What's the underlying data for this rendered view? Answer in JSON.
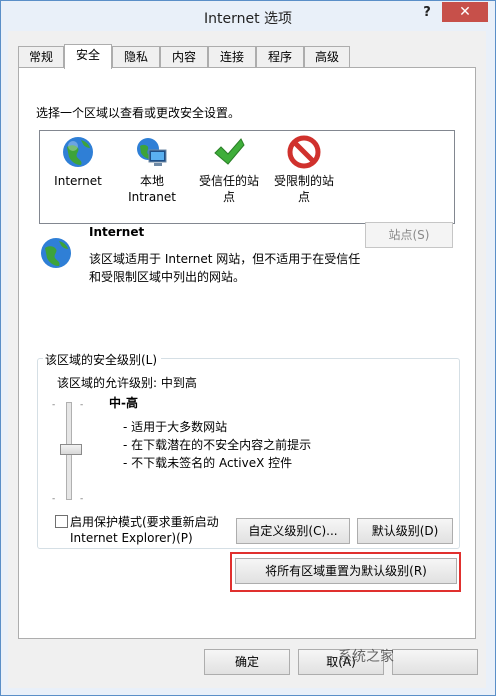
{
  "window": {
    "title": "Internet 选项",
    "help_label": "?",
    "close_label": "✕"
  },
  "tabs": [
    {
      "label": "常规"
    },
    {
      "label": "安全"
    },
    {
      "label": "隐私"
    },
    {
      "label": "内容"
    },
    {
      "label": "连接"
    },
    {
      "label": "程序"
    },
    {
      "label": "高级"
    }
  ],
  "security": {
    "select_zone_text": "选择一个区域以查看或更改安全设置。",
    "zones": [
      {
        "line1": "Internet",
        "line2": "",
        "icon": "globe-icon"
      },
      {
        "line1": "本地",
        "line2": "Intranet",
        "icon": "intranet-icon"
      },
      {
        "line1": "受信任的站",
        "line2": "点",
        "icon": "green-check-icon"
      },
      {
        "line1": "受限制的站",
        "line2": "点",
        "icon": "red-prohibited-icon"
      }
    ],
    "selected_zone": {
      "name": "Internet",
      "desc1": "该区域适用于 Internet 网站，但不适用于在受信任",
      "desc2": "和受限制区域中列出的网站。"
    },
    "sites_button": "站点(S)",
    "level_group": {
      "legend": "该区域的安全级别(L)",
      "allowed": "该区域的允许级别: 中到高",
      "level_name": "中-高",
      "bullets": [
        "- 适用于大多数网站",
        "- 在下载潜在的不安全内容之前提示",
        "- 不下载未签名的 ActiveX 控件"
      ],
      "slider_level": 0.5
    },
    "protected_mode": {
      "line1": "启用保护模式(要求重新启动",
      "line2": "Internet Explorer)(P)",
      "checked": false
    },
    "custom_level_button": "自定义级别(C)...",
    "default_level_button": "默认级别(D)",
    "reset_all_button": "将所有区域重置为默认级别(R)"
  },
  "footer": {
    "ok_label": "确定",
    "cancel_label": "取(A)"
  },
  "watermark": "系统之家",
  "colors": {
    "close": "#c7504a",
    "highlight": "#e0302e",
    "border": "#5a8fc8"
  }
}
